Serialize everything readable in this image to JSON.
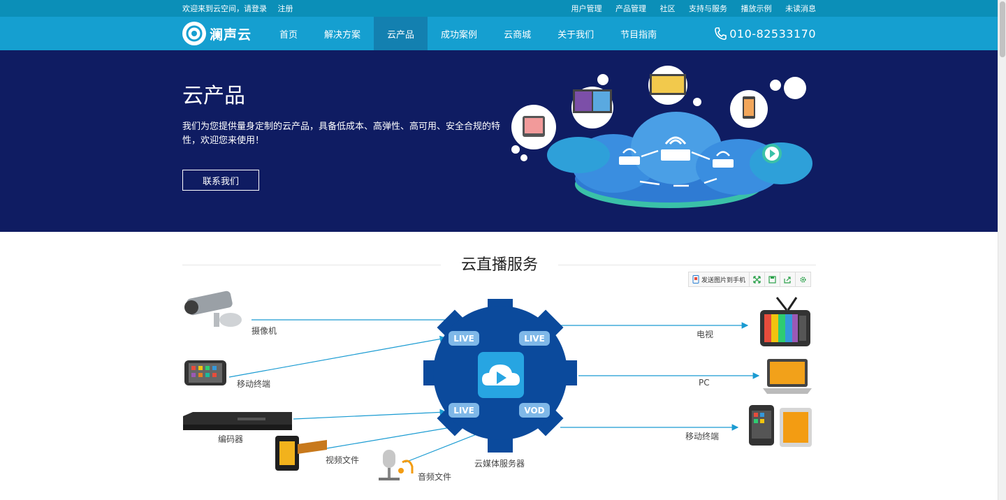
{
  "topbar": {
    "welcome": "欢迎来到云空间，请登录",
    "register": "注册",
    "links": [
      "用户管理",
      "产品管理",
      "社区",
      "支持与服务",
      "播放示例",
      "未读消息"
    ]
  },
  "nav": {
    "logo_text": "澜声云",
    "items": [
      "首页",
      "解决方案",
      "云产品",
      "成功案例",
      "云商城",
      "关于我们",
      "节目指南"
    ],
    "active_index": 2,
    "phone": "010-82533170"
  },
  "hero": {
    "title": "云产品",
    "description": "我们为您提供量身定制的云产品，具备低成本、高弹性、高可用、安全合规的特性，欢迎您来使用！",
    "button": "联系我们"
  },
  "section": {
    "title": "云直播服务"
  },
  "toolbar": {
    "send_label": "发送图片到手机"
  },
  "diagram": {
    "inputs": [
      "摄像机",
      "移动终端",
      "编码器",
      "视频文件",
      "音频文件"
    ],
    "outputs": [
      "电视",
      "PC",
      "移动终端"
    ],
    "server_label": "云媒体服务器",
    "badges": [
      "LIVE",
      "LIVE",
      "LIVE",
      "VOD"
    ]
  },
  "colors": {
    "topbar": "#0b8fb8",
    "nav": "#159fd0",
    "nav_active": "#1380b0",
    "hero": "#0f1c62",
    "gear": "#0b4a9c",
    "arrow": "#1a9bd2"
  }
}
